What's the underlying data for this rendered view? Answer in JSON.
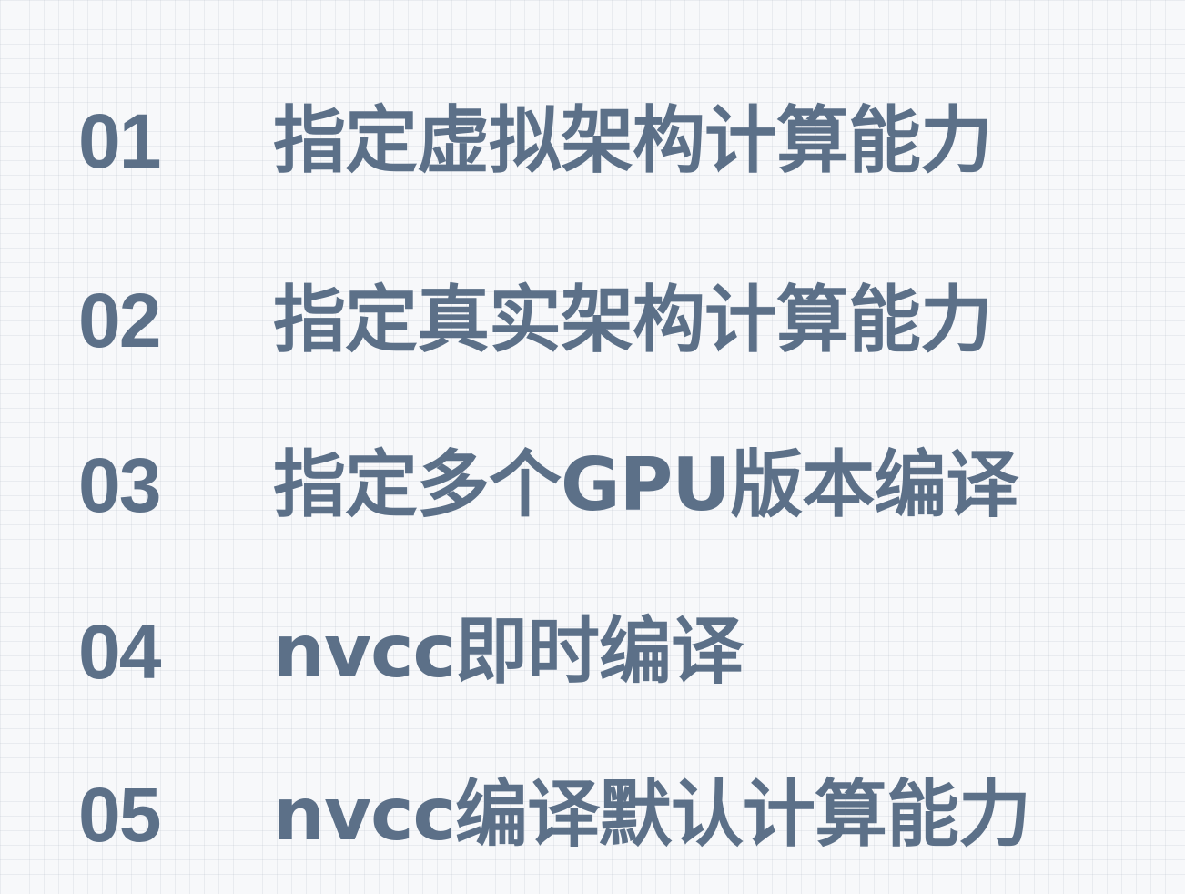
{
  "items": [
    {
      "number": "01",
      "label": "指定虚拟架构计算能力"
    },
    {
      "number": "02",
      "label": "指定真实架构计算能力"
    },
    {
      "number": "03",
      "label": "指定多个GPU版本编译"
    },
    {
      "number": "04",
      "label": "nvcc即时编译"
    },
    {
      "number": "05",
      "label": "nvcc编译默认计算能力"
    }
  ],
  "colors": {
    "text": "#5c7088",
    "background": "#f7f8fa"
  }
}
